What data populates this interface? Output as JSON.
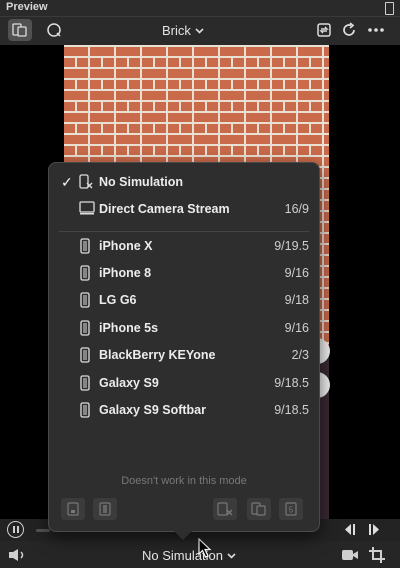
{
  "window": {
    "title": "Preview"
  },
  "toolbar": {
    "device_label": "Brick"
  },
  "menu": {
    "items": [
      {
        "label": "No Simulation",
        "ratio": "",
        "icon": "no-device-icon",
        "checked": true
      },
      {
        "label": "Direct Camera Stream",
        "ratio": "16/9",
        "icon": "monitor-icon",
        "checked": false
      },
      {
        "label": "iPhone X",
        "ratio": "9/19.5",
        "icon": "phone-icon",
        "checked": false
      },
      {
        "label": "iPhone 8",
        "ratio": "9/16",
        "icon": "phone-icon",
        "checked": false
      },
      {
        "label": "LG G6",
        "ratio": "9/18",
        "icon": "phone-icon",
        "checked": false
      },
      {
        "label": "iPhone 5s",
        "ratio": "9/16",
        "icon": "phone-icon",
        "checked": false
      },
      {
        "label": "BlackBerry KEYone",
        "ratio": "2/3",
        "icon": "phone-icon",
        "checked": false
      },
      {
        "label": "Galaxy S9",
        "ratio": "9/18.5",
        "icon": "phone-icon",
        "checked": false
      },
      {
        "label": "Galaxy S9 Softbar",
        "ratio": "9/18.5",
        "icon": "phone-icon",
        "checked": false
      }
    ],
    "hint": "Doesn't work in this mode"
  },
  "bottom": {
    "simulation_label": "No Simulation"
  },
  "colors": {
    "panel": "#2e2e2f",
    "background": "#1e1e1e",
    "brick": "#c96a4a"
  }
}
